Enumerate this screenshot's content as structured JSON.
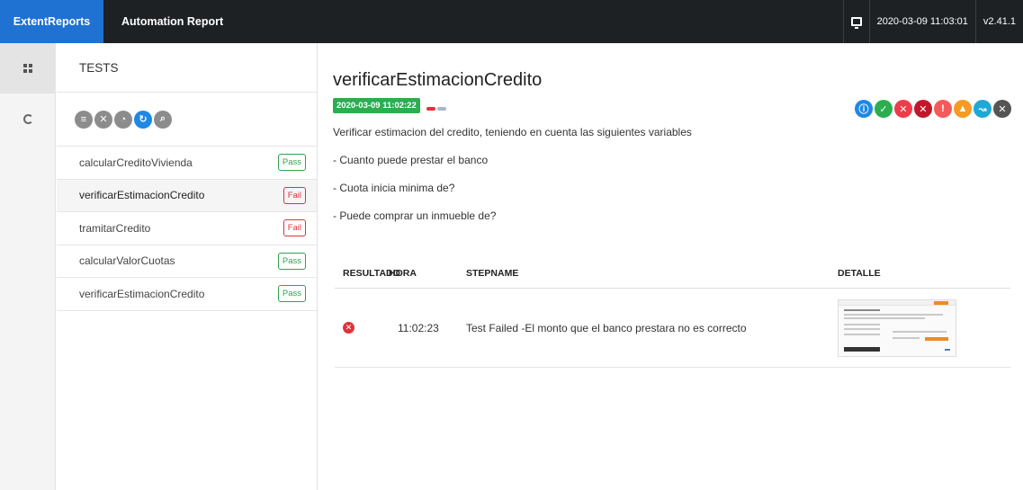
{
  "topbar": {
    "brand": "ExtentReports",
    "title": "Automation Report",
    "datetime": "2020-03-09 11:03:01",
    "version": "v2.41.1"
  },
  "rail": {
    "items": [
      {
        "icon": "dashboard-grid-icon",
        "active": true
      },
      {
        "icon": "spiral-icon",
        "active": false
      }
    ]
  },
  "panel": {
    "title": "TESTS",
    "filters": [
      {
        "icon": "list-icon",
        "color": "#8c8c8c"
      },
      {
        "icon": "close-icon",
        "color": "#8c8c8c"
      },
      {
        "icon": "spiral-icon",
        "color": "#8c8c8c"
      },
      {
        "icon": "refresh-icon",
        "color": "#1e88e5"
      },
      {
        "icon": "search-icon",
        "color": "#8c8c8c"
      }
    ],
    "tests": [
      {
        "name": "calcularCreditoVivienda",
        "status": "Pass"
      },
      {
        "name": "verificarEstimacionCredito",
        "status": "Fail"
      },
      {
        "name": "tramitarCredito",
        "status": "Fail"
      },
      {
        "name": "calcularValorCuotas",
        "status": "Pass"
      },
      {
        "name": "verificarEstimacionCredito",
        "status": "Pass"
      }
    ]
  },
  "main": {
    "test_name": "verificarEstimacionCredito",
    "time_badge": "2020-03-09 11:02:22",
    "status_icons": [
      {
        "icon": "info-icon",
        "color": "#1e88e5"
      },
      {
        "icon": "check-icon",
        "color": "#2cae4e"
      },
      {
        "icon": "fail-icon",
        "color": "#ef3b4a"
      },
      {
        "icon": "fatal-icon",
        "color": "#c0182a"
      },
      {
        "icon": "error-icon",
        "color": "#f55a5a"
      },
      {
        "icon": "warning-icon",
        "color": "#f59a23"
      },
      {
        "icon": "skip-icon",
        "color": "#1fa8d6"
      },
      {
        "icon": "close-icon",
        "color": "#555555"
      }
    ],
    "description": [
      "Verificar estimacion del credito, teniendo en cuenta las siguientes variables",
      "- Cuanto puede prestar el banco",
      "- Cuota inicia minima de?",
      "- Puede comprar un inmueble de?"
    ],
    "steps": {
      "headers": {
        "result": "RESULTADO",
        "time": "HORA",
        "stepname": "STEPNAME",
        "detail": "DETALLE"
      },
      "rows": [
        {
          "status": "fail",
          "time": "11:02:23",
          "stepname": "Test Failed -El monto que el banco prestara no es correcto"
        }
      ]
    }
  },
  "colors": {
    "brand": "#1f72d2",
    "topbar": "#1e2124",
    "pass": "#32a14e",
    "fail": "#e0323c"
  }
}
